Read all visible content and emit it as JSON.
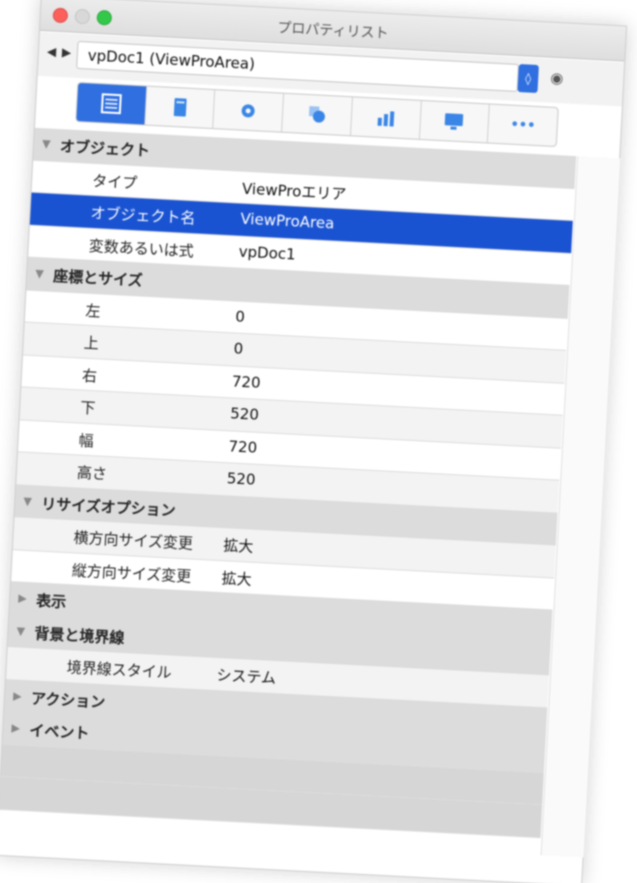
{
  "window": {
    "title": "プロパティリスト"
  },
  "nav": {
    "arrows": "◀ ▶",
    "selector_value": "vpDoc1 (ViewProArea)",
    "selector_button": "◊",
    "eye": "◉"
  },
  "tabs": [
    {
      "icon": "list-icon",
      "active": true
    },
    {
      "icon": "document-icon",
      "active": false
    },
    {
      "icon": "gear-icon",
      "active": false
    },
    {
      "icon": "shape-icon",
      "active": false
    },
    {
      "icon": "chart-icon",
      "active": false
    },
    {
      "icon": "monitor-icon",
      "active": false
    },
    {
      "icon": "more-icon",
      "active": false
    }
  ],
  "sections": {
    "object": {
      "title": "オブジェクト",
      "type_label": "タイプ",
      "type_value": "ViewProエリア",
      "name_label": "オブジェクト名",
      "name_value": "ViewProArea",
      "var_label": "変数あるいは式",
      "var_value": "vpDoc1"
    },
    "coords": {
      "title": "座標とサイズ",
      "left_label": "左",
      "left_value": "0",
      "top_label": "上",
      "top_value": "0",
      "right_label": "右",
      "right_value": "720",
      "bottom_label": "下",
      "bottom_value": "520",
      "width_label": "幅",
      "width_value": "720",
      "height_label": "高さ",
      "height_value": "520"
    },
    "resize": {
      "title": "リサイズオプション",
      "h_label": "横方向サイズ変更",
      "h_value": "拡大",
      "v_label": "縦方向サイズ変更",
      "v_value": "拡大"
    },
    "display": {
      "title": "表示"
    },
    "background": {
      "title": "背景と境界線",
      "border_label": "境界線スタイル",
      "border_value": "システム"
    },
    "action": {
      "title": "アクション"
    },
    "event": {
      "title": "イベント"
    }
  },
  "glyphs": {
    "expanded": "▼",
    "collapsed": "▶",
    "spinner": "▲▼",
    "more": "•••"
  },
  "colors": {
    "selection": "#1a53d2",
    "tab_active": "#2f6fe0",
    "section_bg": "#dcdcdc"
  }
}
